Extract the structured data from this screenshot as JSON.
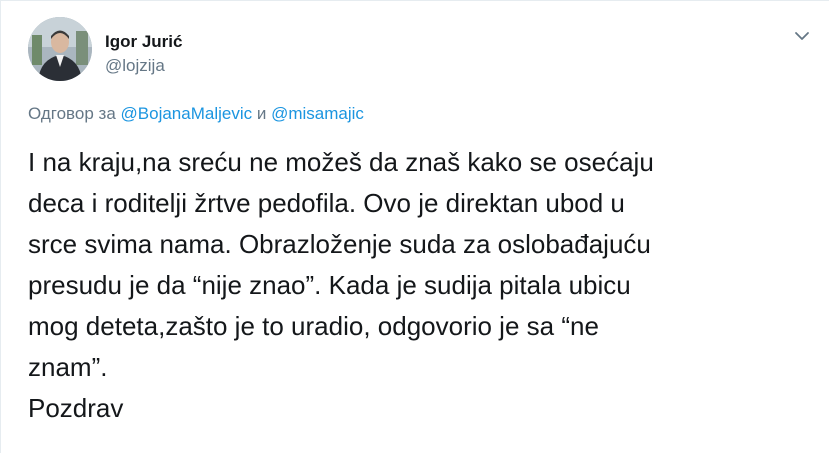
{
  "author": {
    "name": "Igor Jurić",
    "handle": "@lojzija",
    "avatar_icon": "profile-photo"
  },
  "reply_to": {
    "prefix": "Одговор за",
    "user1": "@BojanaMaljevic",
    "conjunction": "и",
    "user2": "@misamajic"
  },
  "tweet": {
    "lines": [
      "I na kraju,na sreću ne možeš da znaš kako se osećaju",
      "deca i roditelji žrtve pedofila. Ovo je direktan ubod u",
      "srce svima nama. Obrazloženje suda za oslobađajuću",
      "presudu je da “nije znao”. Kada je sudija pitala ubicu",
      "mog deteta,zašto je to uradio, odgovorio je sa “ne",
      "znam”.",
      "Pozdrav"
    ]
  },
  "menu": {
    "icon": "chevron-down-icon"
  },
  "colors": {
    "link": "#1b95e0",
    "secondary": "#657786",
    "text": "#14171a"
  }
}
